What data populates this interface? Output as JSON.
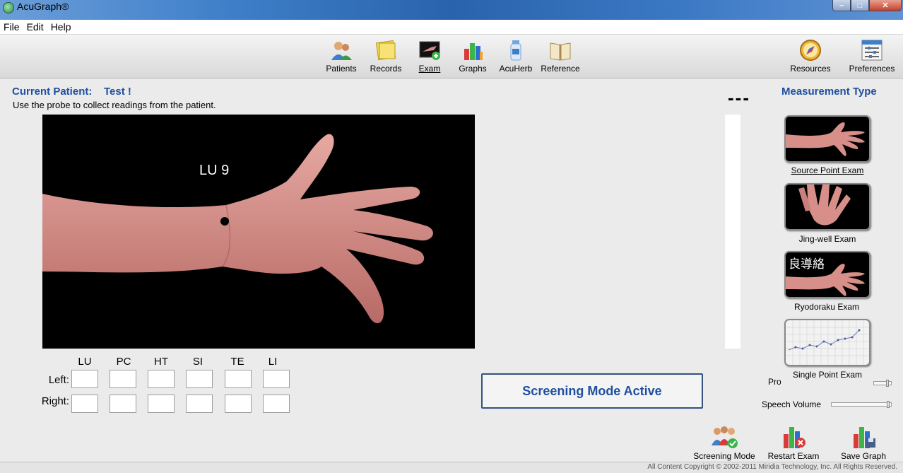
{
  "window": {
    "title": "AcuGraph®"
  },
  "menu": [
    "File",
    "Edit",
    "Help"
  ],
  "toolbar": {
    "items": [
      {
        "label": "Patients",
        "icon": "patients-icon"
      },
      {
        "label": "Records",
        "icon": "records-icon"
      },
      {
        "label": "Exam",
        "icon": "exam-icon",
        "active": true
      },
      {
        "label": "Graphs",
        "icon": "graphs-icon"
      },
      {
        "label": "AcuHerb",
        "icon": "acuherb-icon"
      },
      {
        "label": "Reference",
        "icon": "reference-icon"
      }
    ],
    "right_items": [
      {
        "label": "Resources",
        "icon": "compass-icon"
      },
      {
        "label": "Preferences",
        "icon": "preferences-icon"
      }
    ]
  },
  "patient": {
    "label": "Current Patient:",
    "name": "Test !",
    "instructions": "Use the probe to collect readings from the patient."
  },
  "exam": {
    "point_label": "LU 9",
    "reading_value": "---"
  },
  "measurement": {
    "title": "Measurement Type",
    "types": [
      {
        "label": "Source Point Exam",
        "selected": true
      },
      {
        "label": "Jing-well Exam"
      },
      {
        "label": "Ryodoraku Exam",
        "overlay": "良導絡"
      },
      {
        "label": "Single Point Exam"
      }
    ]
  },
  "grid": {
    "columns": [
      "LU",
      "PC",
      "HT",
      "SI",
      "TE",
      "LI"
    ],
    "rows": [
      {
        "label": "Left:",
        "values": [
          "",
          "",
          "",
          "",
          "",
          ""
        ]
      },
      {
        "label": "Right:",
        "values": [
          "",
          "",
          "",
          "",
          "",
          ""
        ]
      }
    ]
  },
  "status": {
    "screening": "Screening Mode Active"
  },
  "controls": {
    "pro_label": "Pro",
    "speech_label": "Speech Volume",
    "pro_level": 0.95,
    "speech_level": 1.0
  },
  "actions": [
    {
      "label": "Screening Mode",
      "icon": "screening-mode-icon"
    },
    {
      "label": "Restart Exam",
      "icon": "restart-exam-icon"
    },
    {
      "label": "Save Graph",
      "icon": "save-graph-icon"
    }
  ],
  "footer": {
    "copyright": "All Content Copyright © 2002-2011 Miridia Technology, Inc.  All Rights Reserved."
  },
  "colors": {
    "heading_blue": "#1f4fa0",
    "status_border": "#34527e"
  }
}
